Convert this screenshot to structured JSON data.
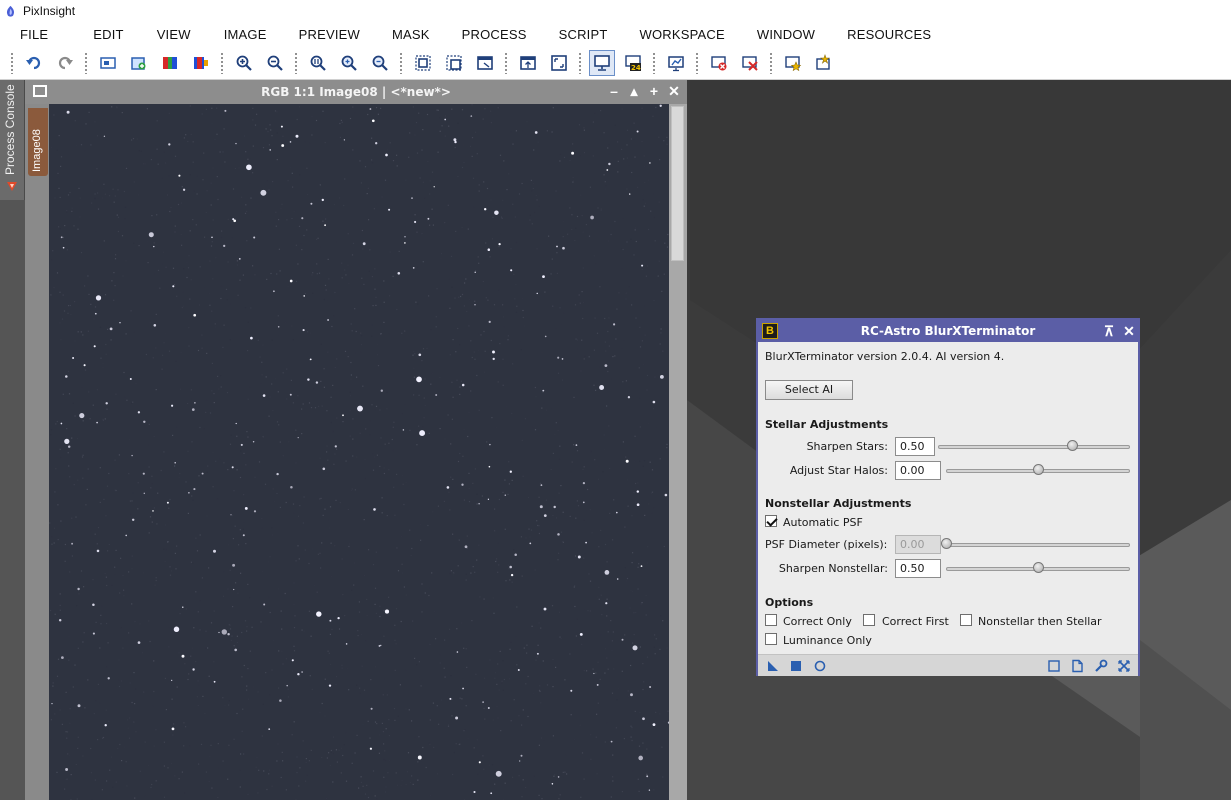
{
  "window": {
    "title": "PixInsight"
  },
  "menu": [
    "FILE",
    "EDIT",
    "VIEW",
    "IMAGE",
    "PREVIEW",
    "MASK",
    "PROCESS",
    "SCRIPT",
    "WORKSPACE",
    "WINDOW",
    "RESOURCES"
  ],
  "toolbar": {
    "buttons": [
      "undo-icon",
      "redo-icon",
      "image-info-icon",
      "new-image-icon",
      "color-channels-icon",
      "rgb-channels-icon",
      "zoom-in-icon",
      "zoom-out-icon",
      "zoom-1-1-icon",
      "zoom-in-view-icon",
      "zoom-out-view-icon",
      "zoom-to-fit-icon",
      "fit-view-icon",
      "zoom-to-window-icon",
      "restore-view-icon",
      "maximize-view-icon",
      "screen-transfer-icon",
      "stf-24bit-icon",
      "auto-stretch-icon",
      "mask-reset-icon",
      "mask-clear-icon",
      "favorites-icon",
      "process-explorer-icon"
    ]
  },
  "dock": {
    "process_console_label": "Process Console"
  },
  "image_window": {
    "title": "RGB 1:1 Image08 | <*new*>",
    "tab_label": "Image08"
  },
  "dialog": {
    "title": "RC-Astro BlurXTerminator",
    "icon_letter": "B",
    "version_text": "BlurXTerminator version 2.0.4. AI version 4.",
    "select_ai_label": "Select AI",
    "stellar": {
      "heading": "Stellar Adjustments",
      "sharpen_stars_label": "Sharpen Stars:",
      "sharpen_stars_value": "0.50",
      "sharpen_stars_slider": 0.7,
      "adjust_halos_label": "Adjust Star Halos:",
      "adjust_halos_value": "0.00",
      "adjust_halos_slider": 0.5
    },
    "nonstellar": {
      "heading": "Nonstellar Adjustments",
      "auto_psf_label": "Automatic PSF",
      "auto_psf_checked": true,
      "psf_diameter_label": "PSF Diameter (pixels):",
      "psf_diameter_value": "0.00",
      "psf_diameter_slider": 0.0,
      "sharpen_nonstellar_label": "Sharpen Nonstellar:",
      "sharpen_nonstellar_value": "0.50",
      "sharpen_nonstellar_slider": 0.5
    },
    "options": {
      "heading": "Options",
      "correct_only_label": "Correct Only",
      "correct_first_label": "Correct First",
      "nonstellar_then_stellar_label": "Nonstellar then Stellar",
      "luminance_only_label": "Luminance Only"
    }
  },
  "colors": {
    "dialog_accent": "#5b5ea6",
    "workspace": "#3a3a3a",
    "image_background": "#2e3340",
    "image_tab": "#8b5a3c"
  }
}
